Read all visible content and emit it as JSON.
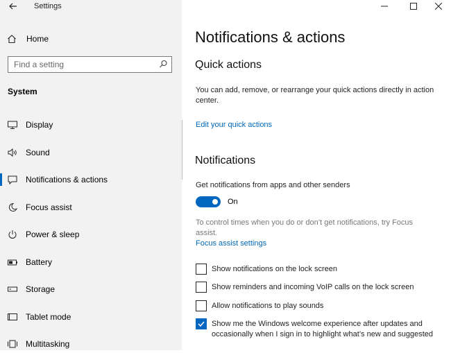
{
  "window": {
    "title": "Settings",
    "icons": {
      "back": "arrow-left-icon",
      "minimize": "minimize-icon",
      "maximize": "maximize-icon",
      "close": "close-icon"
    }
  },
  "sidebar": {
    "home_label": "Home",
    "search_placeholder": "Find a setting",
    "section_title": "System",
    "items": [
      {
        "label": "Display",
        "icon": "display-icon"
      },
      {
        "label": "Sound",
        "icon": "sound-icon"
      },
      {
        "label": "Notifications & actions",
        "icon": "notifications-icon",
        "active": true
      },
      {
        "label": "Focus assist",
        "icon": "moon-icon"
      },
      {
        "label": "Power & sleep",
        "icon": "power-icon"
      },
      {
        "label": "Battery",
        "icon": "battery-icon"
      },
      {
        "label": "Storage",
        "icon": "storage-icon"
      },
      {
        "label": "Tablet mode",
        "icon": "tablet-icon"
      },
      {
        "label": "Multitasking",
        "icon": "multitasking-icon"
      }
    ]
  },
  "main": {
    "page_title": "Notifications & actions",
    "quick_actions": {
      "heading": "Quick actions",
      "description": "You can add, remove, or rearrange your quick actions directly in action center.",
      "link": "Edit your quick actions"
    },
    "notifications": {
      "heading": "Notifications",
      "toggle_label": "Get notifications from apps and other senders",
      "toggle_state": "On",
      "toggle_on": true,
      "focus_hint": "To control times when you do or don’t get notifications, try Focus assist.",
      "focus_link": "Focus assist settings",
      "checkboxes": [
        {
          "label": "Show notifications on the lock screen",
          "checked": false
        },
        {
          "label": "Show reminders and incoming VoIP calls on the lock screen",
          "checked": false
        },
        {
          "label": "Allow notifications to play sounds",
          "checked": false
        },
        {
          "label": "Show me the Windows welcome experience after updates and occasionally when I sign in to highlight what’s new and suggested",
          "checked": true
        }
      ]
    }
  },
  "colors": {
    "accent": "#0067c0",
    "sidebar_bg": "#f2f2f2",
    "link": "#0067b8"
  }
}
